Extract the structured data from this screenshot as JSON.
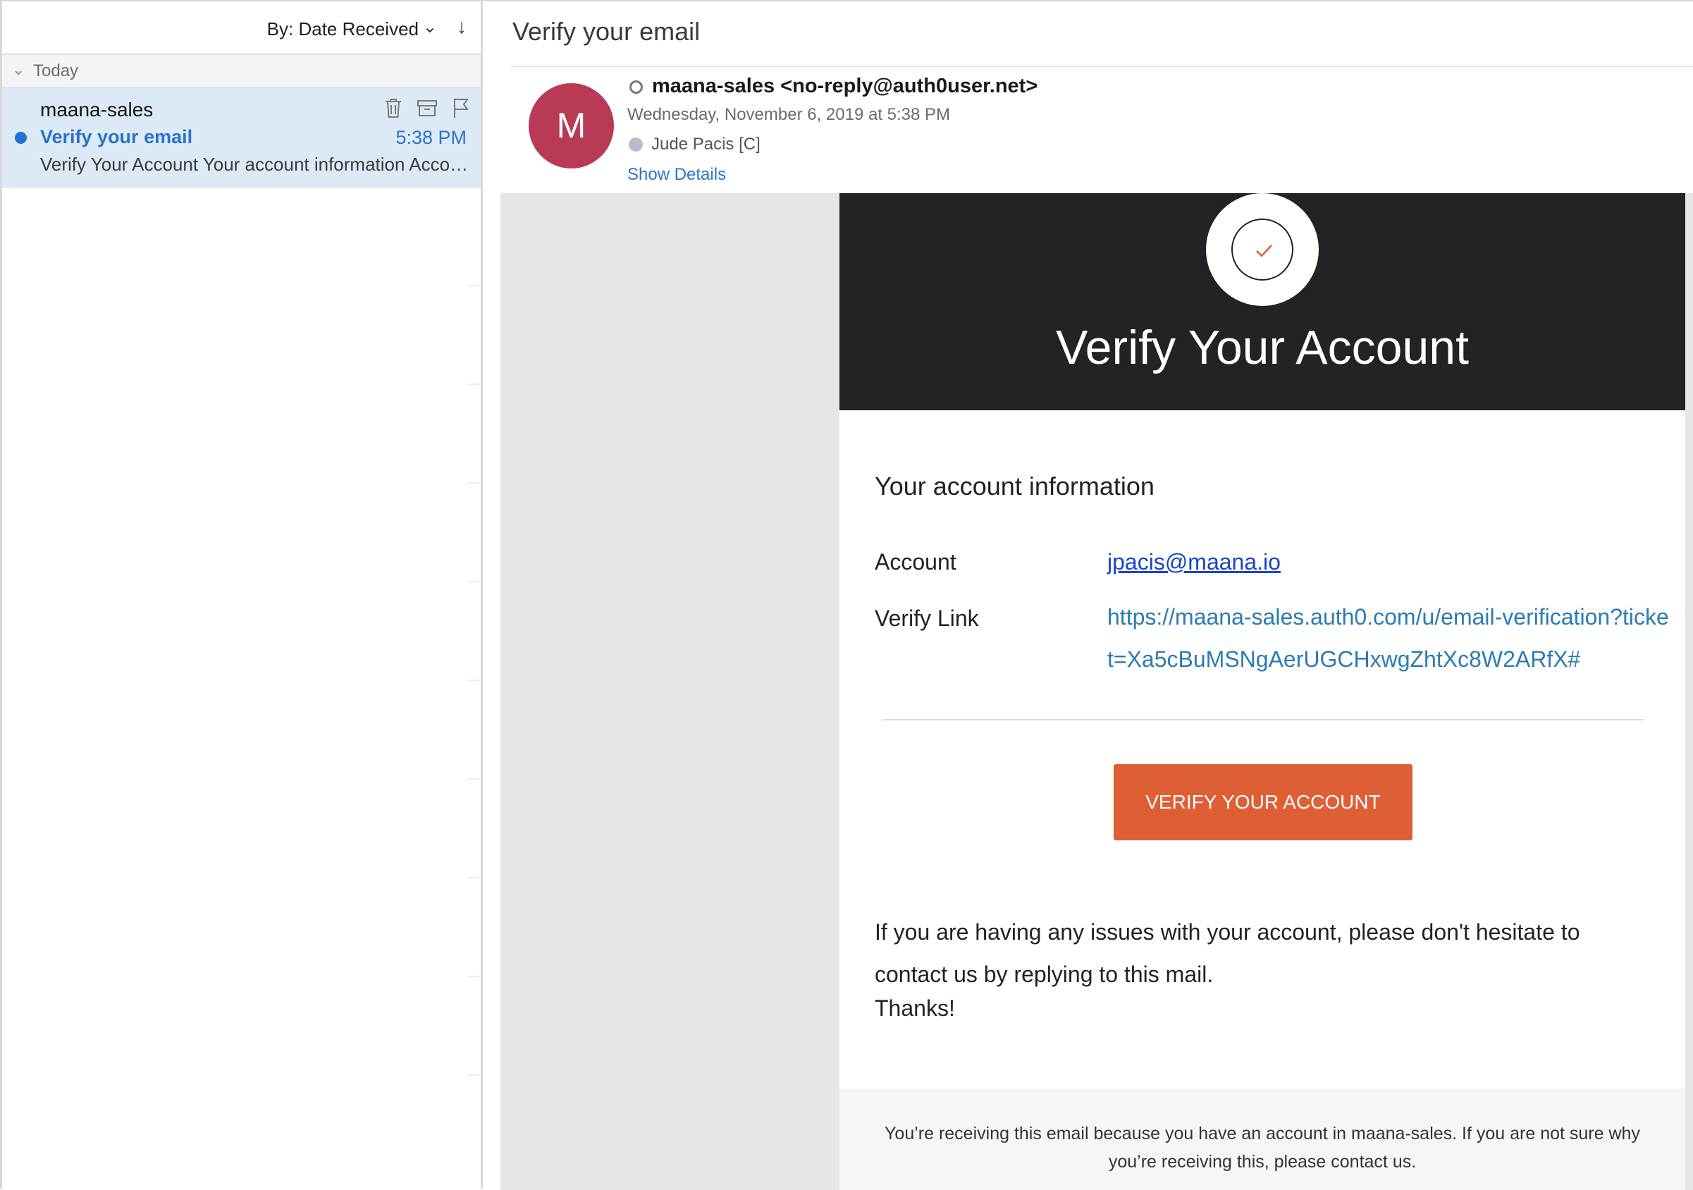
{
  "message_list": {
    "sort_label": "By: Date Received",
    "group_label": "Today",
    "selected_message": {
      "sender": "maana-sales",
      "subject": "Verify your email",
      "time": "5:38 PM",
      "preview": "Verify Your Account Your account information Account jpacis@maana.io Verify Link https://maana-sales.auth0.com/u/email-verification?ticket=Xa5cBuMSNgAerUGCHxwgZhtXc8W2ARfX#"
    }
  },
  "reader": {
    "title": "Verify your email",
    "avatar_initial": "M",
    "from": "maana-sales <no-reply@auth0user.net>",
    "date": "Wednesday, November 6, 2019 at 5:38 PM",
    "to": "Jude Pacis [C]",
    "show_details": "Show Details"
  },
  "email": {
    "hero_title": "Verify Your Account",
    "section_title": "Your account information",
    "account_label": "Account",
    "account_value": "jpacis@maana.io",
    "verify_label": "Verify Link",
    "verify_link": "https://maana-sales.auth0.com/u/email-verification?ticket=Xa5cBuMSNgAerUGCHxwgZhtXc8W2ARfX#",
    "button_label": "VERIFY YOUR ACCOUNT",
    "help_text": "If you are having any issues with your account, please don't hesitate to contact us by replying to this mail.",
    "thanks_text": "Thanks!",
    "footer_text": "You’re receiving this email because you have an account in maana-sales. If you are not sure why you’re receiving this, please contact us."
  },
  "colors": {
    "accent_blue": "#2a73cc",
    "avatar": "#b83a55",
    "hero_background": "#222227",
    "button": "#df5f34"
  },
  "icons": {
    "sort_chevron": "chevron-down-icon",
    "sort_direction": "arrow-down-icon",
    "group_chevron": "chevron-down-icon",
    "trash": "trash-icon",
    "archive": "archive-icon",
    "flag": "flag-icon",
    "check": "check-icon"
  }
}
